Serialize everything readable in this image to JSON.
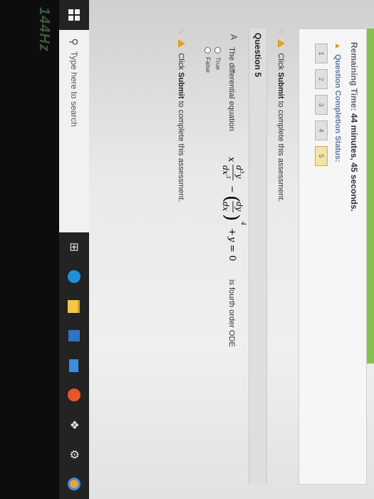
{
  "status": {
    "timer_lead": "Remaining Time:",
    "timer_value": "44 minutes, 45 seconds.",
    "completion_label": "Question Completion Status:",
    "question_buttons": [
      "1",
      "2",
      "3",
      "4",
      "5"
    ]
  },
  "instructions": {
    "prefix": "Click",
    "action": "Submit",
    "suffix": "to complete this assessment."
  },
  "question": {
    "title": "Question 5",
    "answer_label": "A",
    "text": "The differential equation",
    "suffix": "is fourth order ODE",
    "options": [
      "True",
      "False"
    ]
  },
  "taskbar": {
    "search_placeholder": "Type here to search",
    "task_view_icon": "task-view-icon",
    "edge_icon": "edge-icon",
    "explorer_icon": "file-explorer-icon",
    "store_icon": "store-icon",
    "mail_icon": "mail-icon",
    "firefox_icon": "firefox-icon",
    "dropbox_icon": "dropbox-icon",
    "settings_icon": "settings-icon",
    "chrome_icon": "chrome-icon"
  },
  "monitor": {
    "brand_label": "144Hz"
  },
  "colors": {
    "progress_green": "#86c24b",
    "warning_orange": "#e0a31c",
    "taskbar": "#232323",
    "edge_blue": "#1f8fd6",
    "chrome_orange": "#e9a43a"
  }
}
